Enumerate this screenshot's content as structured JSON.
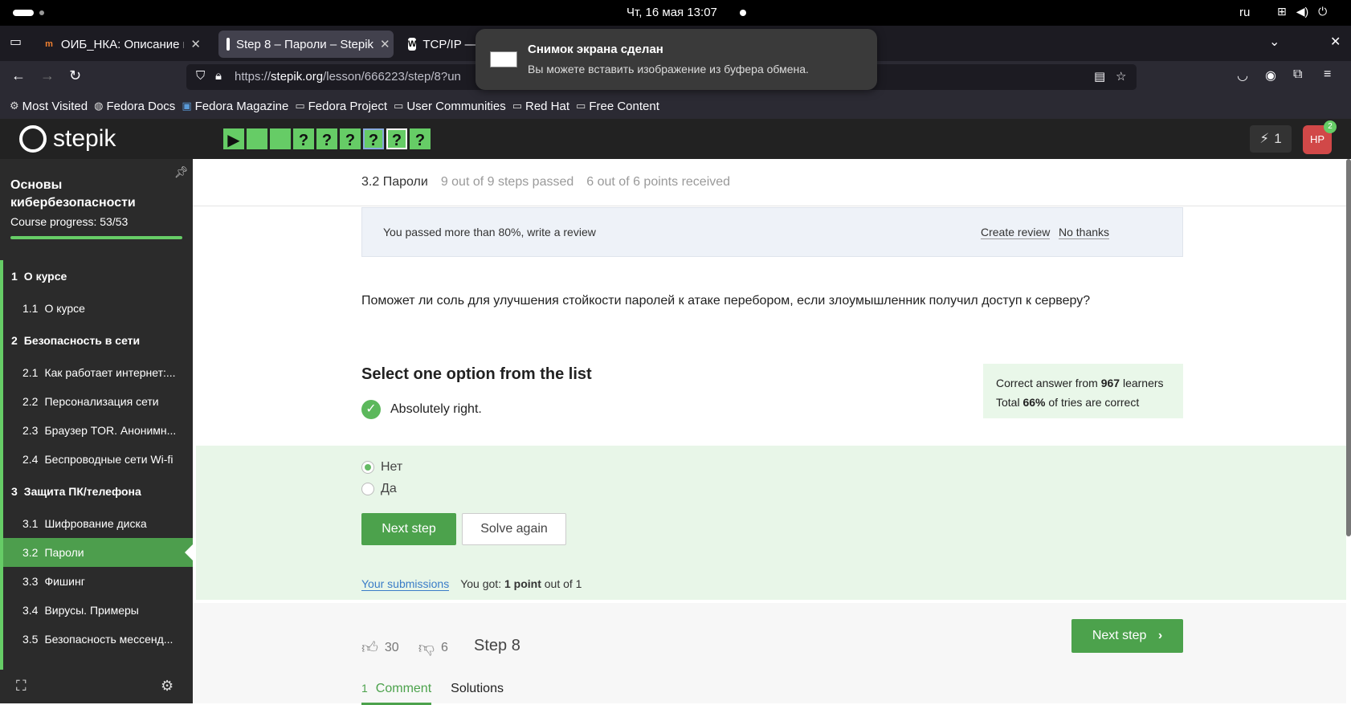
{
  "system_bar": {
    "clock": "Чт, 16 мая  13:07",
    "lang": "ru"
  },
  "browser": {
    "tabs": [
      {
        "label": "ОИБ_НКА: Описание вне",
        "active": false
      },
      {
        "label": "Step 8 – Пароли – Stepik",
        "active": true
      },
      {
        "label": "TCP/IP —",
        "active": false
      }
    ],
    "url_prefix": "https://",
    "url_domain": "stepik.org",
    "url_rest": "/lesson/666223/step/8?un",
    "bookmarks": [
      "Most Visited",
      "Fedora Docs",
      "Fedora Magazine",
      "Fedora Project",
      "User Communities",
      "Red Hat",
      "Free Content"
    ]
  },
  "notification": {
    "title": "Снимок экрана сделан",
    "body": "Вы можете вставить изображение из буфера обмена."
  },
  "header": {
    "logo": "stepik",
    "step_squares": [
      "▶",
      "",
      "",
      "?",
      "?",
      "?",
      "?",
      "?",
      "?"
    ],
    "energy": "1",
    "avatar_initials": "НР",
    "avatar_badge": "2"
  },
  "sidebar": {
    "course_title": "Основы кибербезопасности",
    "progress_label": "Course progress:  53/53",
    "items": [
      {
        "num": "1",
        "label": "О курсе",
        "type": "module"
      },
      {
        "num": "1.1",
        "label": "О курсе",
        "type": "lesson"
      },
      {
        "num": "2",
        "label": "Безопасность в сети",
        "type": "module"
      },
      {
        "num": "2.1",
        "label": "Как работает интернет:...",
        "type": "lesson"
      },
      {
        "num": "2.2",
        "label": "Персонализация сети",
        "type": "lesson"
      },
      {
        "num": "2.3",
        "label": "Браузер TOR. Анонимн...",
        "type": "lesson"
      },
      {
        "num": "2.4",
        "label": "Беспроводные сети Wi-fi",
        "type": "lesson"
      },
      {
        "num": "3",
        "label": "Защита ПК/телефона",
        "type": "module"
      },
      {
        "num": "3.1",
        "label": "Шифрование диска",
        "type": "lesson"
      },
      {
        "num": "3.2",
        "label": "Пароли",
        "type": "lesson",
        "active": true
      },
      {
        "num": "3.3",
        "label": "Фишинг",
        "type": "lesson"
      },
      {
        "num": "3.4",
        "label": "Вирусы. Примеры",
        "type": "lesson"
      },
      {
        "num": "3.5",
        "label": "Безопасность мессенд...",
        "type": "lesson"
      }
    ]
  },
  "lesson": {
    "title": "3.2 Пароли",
    "steps_passed": "9 out of 9 steps passed",
    "points": "6 out of 6 points  received"
  },
  "review": {
    "text": "You passed more than 80%, write a review",
    "create": "Create review",
    "no_thanks": "No thanks"
  },
  "question": "Поможет ли соль для улучшения стойкости паролей к атаке перебором, если злоумышленник получил доступ к серверу?",
  "quiz": {
    "instruction": "Select one option from the list",
    "feedback": "Absolutely right.",
    "stats_line1_pre": "Correct answer from ",
    "stats_line1_num": "967",
    "stats_line1_post": " learners",
    "stats_line2_pre": "Total ",
    "stats_line2_num": "66%",
    "stats_line2_post": " of tries are correct",
    "options": [
      {
        "label": "Нет",
        "selected": true
      },
      {
        "label": "Да",
        "selected": false
      }
    ],
    "next_step": "Next step",
    "solve_again": "Solve again",
    "submissions_link": "Your submissions",
    "score_pre": "You got: ",
    "score_bold": "1 point",
    "score_post": " out of 1"
  },
  "footer": {
    "likes": "30",
    "dislikes": "6",
    "step_label": "Step 8",
    "next_step": "Next step",
    "comments_count": "1",
    "comments_tab": "Comment",
    "solutions_tab": "Solutions"
  },
  "colors": {
    "accent": "#4ca24c",
    "sidebar_bg": "#2b2b2b",
    "header_bg": "#222222"
  }
}
